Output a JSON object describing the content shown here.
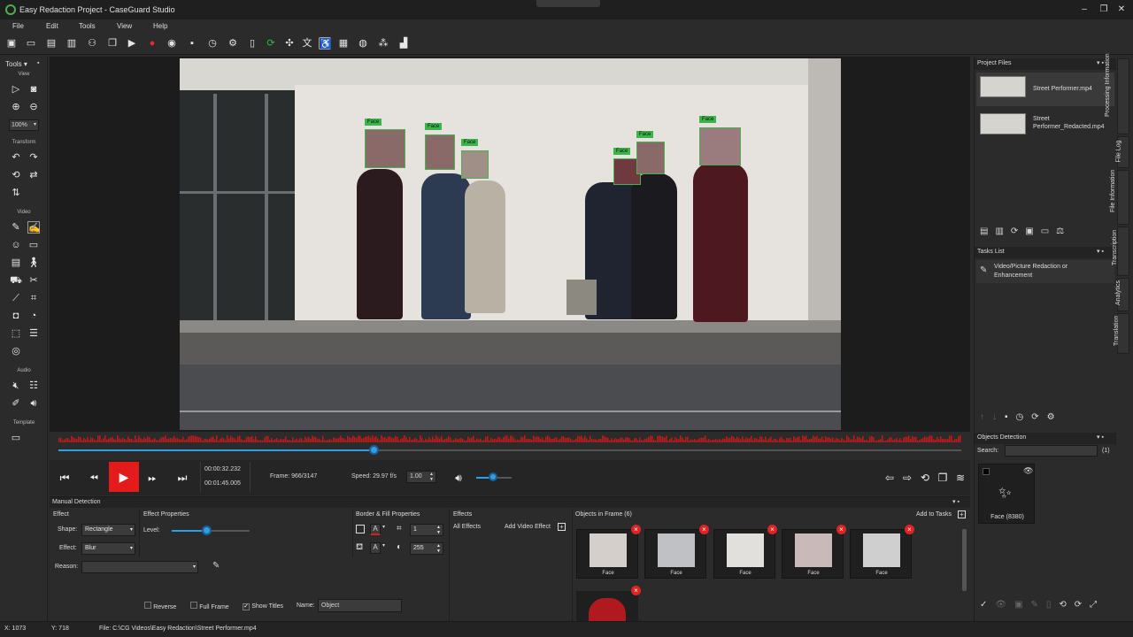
{
  "window": {
    "title": "Easy Redaction Project - CaseGuard Studio"
  },
  "menu": [
    "File",
    "Edit",
    "Tools",
    "View",
    "Help"
  ],
  "tools_panel": {
    "title": "Tools",
    "sections": {
      "view": "View",
      "transform": "Transform",
      "video": "Video",
      "audio": "Audio",
      "template": "Template"
    },
    "zoom": "100%"
  },
  "video": {
    "face_labels": [
      "Face",
      "Face",
      "Face",
      "Face",
      "Face",
      "Face"
    ]
  },
  "transport": {
    "current_time": "00:00:32.232",
    "total_time": "00:01:45.005",
    "frame": "Frame: 966/3147",
    "speed": "Speed: 29.97 f/s",
    "speed_value": "1.00",
    "seek_progress": 0.35,
    "volume_level": 0.5
  },
  "manual": {
    "title": "Manual Detection",
    "effect_header": "Effect",
    "shape_label": "Shape:",
    "shape_value": "Rectangle",
    "effect_label": "Effect:",
    "effect_value": "Blur",
    "reason_label": "Reason:",
    "effect_props_header": "Effect Properties",
    "level_label": "Level:",
    "level_value": 0.45,
    "border_header": "Border & Fill Properties",
    "border_value": "1",
    "fill_value": "255",
    "effects_header": "Effects",
    "all_effects": "All Effects",
    "add_video_effect": "Add Video Effect",
    "objects_header": "Objects in Frame (6)",
    "add_to_tasks": "Add to Tasks",
    "objects": [
      "Face",
      "Face",
      "Face",
      "Face",
      "Face"
    ],
    "reverse": "Reverse",
    "full_frame": "Full Frame",
    "show_titles": "Show Titles",
    "name_label": "Name:",
    "name_value": "Object"
  },
  "right": {
    "project_files_title": "Project Files",
    "files": [
      "Street Performer.mp4",
      "Street Performer_Redacted.mp4"
    ],
    "tasks_title": "Tasks List",
    "task": "Video/Picture Redaction or Enhancement",
    "objects_detection_title": "Objects Detection",
    "search_label": "Search:",
    "search_count": "(1)",
    "detected": "Face (8380)"
  },
  "side_tabs": [
    "Processing Information",
    "File Log",
    "File Information",
    "Transcription",
    "Analytics",
    "Translation"
  ],
  "status": {
    "x": "X:   1073",
    "y": "Y:   718",
    "file": "File: C:\\CG Videos\\Easy Redaction\\Street Performer.mp4"
  },
  "colors": {
    "accent": "#2e9ee6",
    "play": "#e41b1b",
    "face_label": "#39b54a",
    "waveform": "#c11a1a"
  }
}
